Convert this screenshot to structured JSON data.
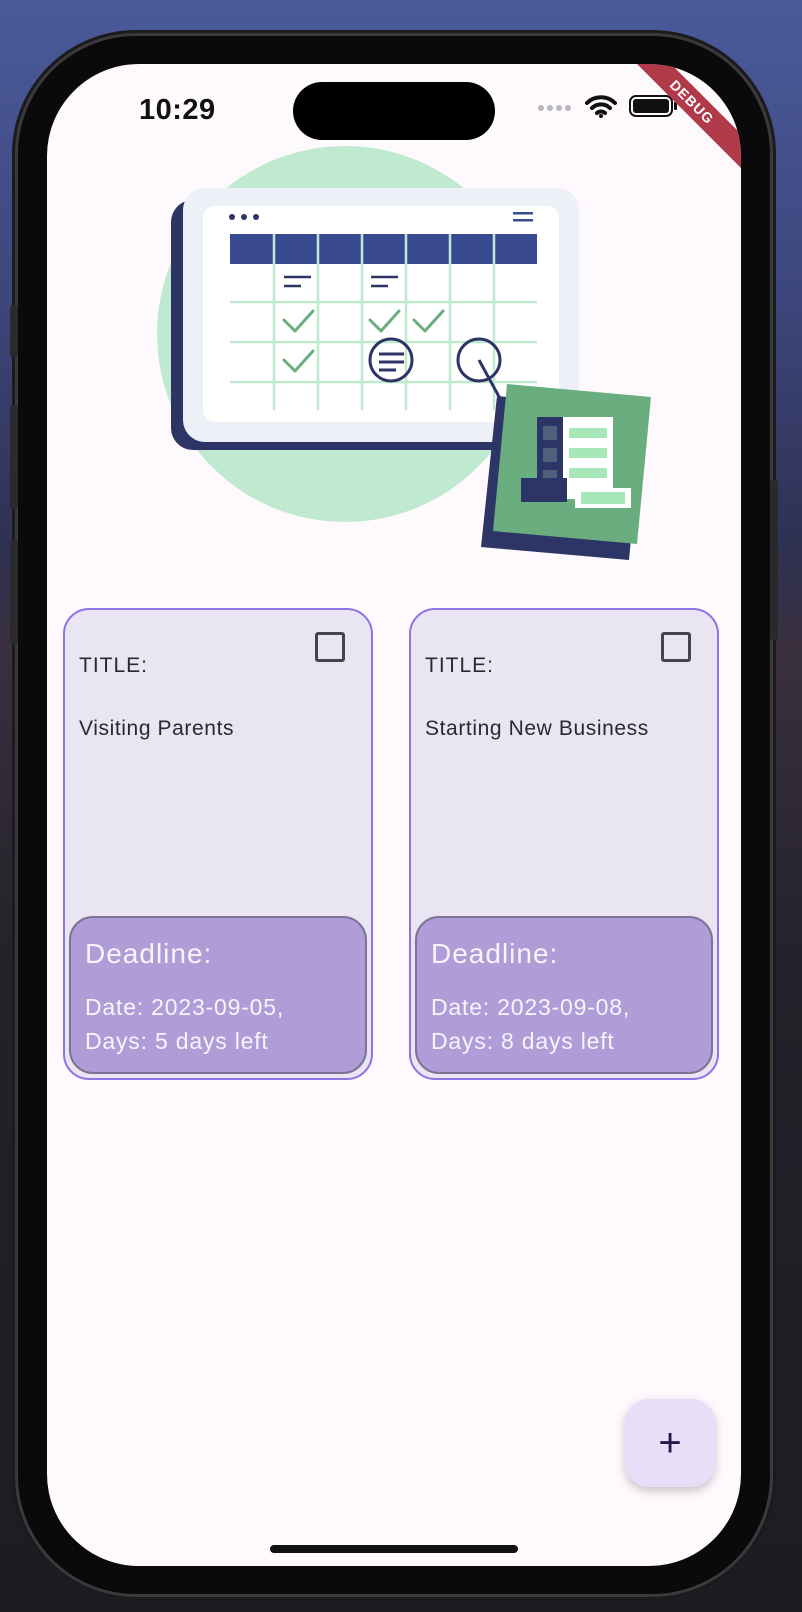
{
  "status_bar": {
    "time": "10:29",
    "debug_banner": "DEBUG",
    "icons": [
      "signal-icon",
      "wifi-icon",
      "battery-icon"
    ]
  },
  "illustration": {
    "icon": "calendar-illustration",
    "colors": {
      "circle": "#c0ead0",
      "navy": "#2d3566",
      "header_blue": "#3a4a90",
      "green": "#6aae80"
    }
  },
  "tasks": [
    {
      "title_label": "TITLE:",
      "title": "Visiting Parents",
      "deadline_label": "Deadline:",
      "date_line": "Date: 2023-09-05,",
      "days_line": "Days: 5 days left",
      "checked": false
    },
    {
      "title_label": "TITLE:",
      "title": "Starting New Business",
      "deadline_label": "Deadline:",
      "date_line": "Date: 2023-09-08,",
      "days_line": "Days: 8 days left",
      "checked": false
    }
  ],
  "fab": {
    "icon": "plus-icon",
    "label": "+"
  },
  "colors": {
    "card_background": "#e9e5f2",
    "card_border": "#8d74e4",
    "deadline_background": "#b09dd8",
    "fab_background": "#e8def8",
    "screen_background": "#fdf9fd"
  }
}
